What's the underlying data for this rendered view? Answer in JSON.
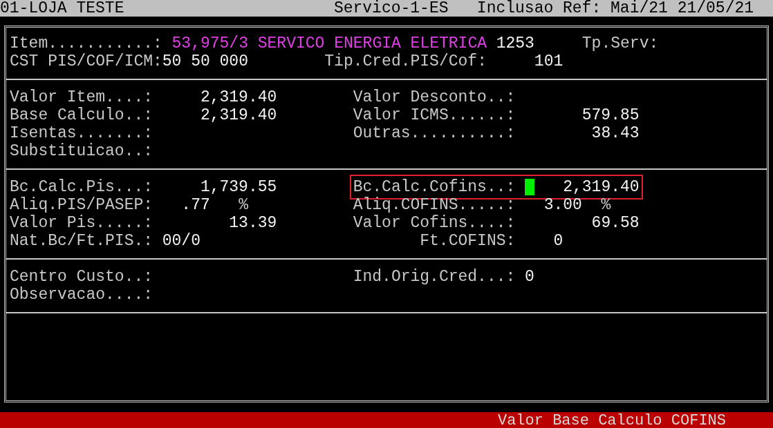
{
  "header": {
    "company": "01-LOJA TESTE",
    "screen": "Servico-1-ES",
    "mode": "Inclusao",
    "reference": "Ref: Mai/21 21/05/21"
  },
  "sections": [
    {
      "fields": [
        {
          "label": "Item...........:",
          "description": "53,975/3 SERVICO ENERGIA ELETRICA",
          "code": "1253",
          "focused": false
        },
        {
          "label": "Tp.Serv:",
          "focused": false
        },
        {
          "label": "CST PIS/COF/ICM:",
          "value": "50 50 000",
          "focused": false
        },
        {
          "label": "Tip.Cred.PIS/Cof:",
          "value": "101",
          "focused": false
        }
      ]
    },
    {
      "fields": [
        {
          "label": "Valor Item....:",
          "value": "2,319.40",
          "focused": false
        },
        {
          "label": "Valor Desconto..:",
          "focused": false
        },
        {
          "label": "Base Calculo..:",
          "value": "2,319.40",
          "focused": false
        },
        {
          "label": "Valor ICMS......:",
          "value": "579.85",
          "focused": false
        },
        {
          "label": "Isentas.......:",
          "focused": false
        },
        {
          "label": "Outras..........:",
          "value": "38.43",
          "focused": false
        },
        {
          "label": "Substituicao..:",
          "focused": false
        }
      ]
    },
    {
      "fields": [
        {
          "label": "Bc.Calc.Pis...:",
          "value": "1,739.55",
          "focused": false
        },
        {
          "label": "Bc.Calc.Cofins..:",
          "value": "2,319.40",
          "focused": true
        },
        {
          "label": "Aliq.PIS/PASEP:",
          "value": ".77",
          "unit": "%",
          "focused": false
        },
        {
          "label": "Aliq.COFINS.....:",
          "value": "3.00",
          "unit": "%",
          "focused": false
        },
        {
          "label": "Valor Pis.....:",
          "value": "13.39",
          "focused": false
        },
        {
          "label": "Valor Cofins....:",
          "value": "69.58",
          "focused": false
        },
        {
          "label": "Nat.Bc/Ft.PIS.:",
          "value": "00/0",
          "focused": false
        },
        {
          "label": "Ft.COFINS:",
          "value": "0",
          "focused": false
        }
      ]
    },
    {
      "fields": [
        {
          "label": "Centro Custo..:",
          "focused": false
        },
        {
          "label": "Ind.Orig.Cred...:",
          "value": "0",
          "focused": false
        },
        {
          "label": "Observacao....:",
          "focused": false
        }
      ]
    }
  ],
  "status_bar": "Valor Base Calculo COFINS"
}
